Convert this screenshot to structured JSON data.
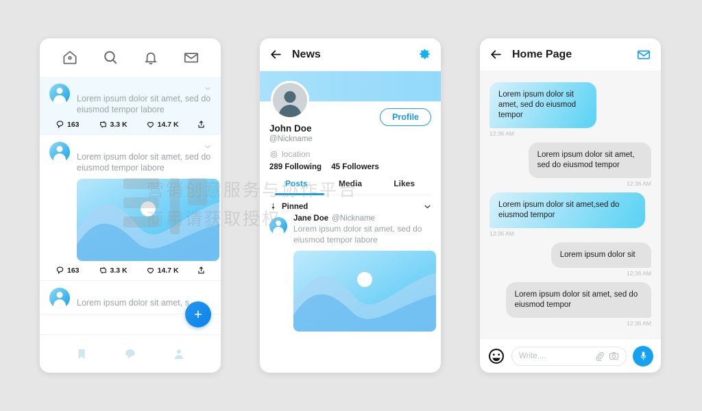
{
  "background_color": "#e6e6e6",
  "accent_color": "#1a9bf0",
  "watermark": {
    "line1": "营销创意服务与协作平台",
    "line2": "商用请获取授权"
  },
  "phone_feed": {
    "top_nav": [
      {
        "name": "home-icon",
        "label": "Home"
      },
      {
        "name": "search-icon",
        "label": "Search"
      },
      {
        "name": "bell-icon",
        "label": "Notifications"
      },
      {
        "name": "mail-icon",
        "label": "Messages"
      }
    ],
    "posts": [
      {
        "text": "Lorem ipsum dolor sit amet, sed do eiusmod tempor labore",
        "highlighted": true,
        "has_image": false,
        "stats": [
          {
            "icon": "comment-icon",
            "value": "163"
          },
          {
            "icon": "retweet-icon",
            "value": "3.3 K"
          },
          {
            "icon": "heart-icon",
            "value": "14.7 K"
          },
          {
            "icon": "share-icon",
            "value": ""
          }
        ]
      },
      {
        "text": "Lorem ipsum dolor sit amet, sed do eiusmod tempor labore",
        "highlighted": false,
        "has_image": true,
        "stats": [
          {
            "icon": "comment-icon",
            "value": "163"
          },
          {
            "icon": "retweet-icon",
            "value": "3.3 K"
          },
          {
            "icon": "heart-icon",
            "value": "14.7 K"
          },
          {
            "icon": "share-icon",
            "value": ""
          }
        ]
      },
      {
        "text": "Lorem ipsum dolor sit amet, s",
        "highlighted": false,
        "has_image": false,
        "stats": []
      }
    ],
    "fab_label": "+",
    "bottom_nav": [
      {
        "name": "bookmark-icon",
        "label": "Bookmarks"
      },
      {
        "name": "chat-bubble-icon",
        "label": "Chats"
      },
      {
        "name": "person-icon",
        "label": "Profile"
      }
    ]
  },
  "phone_profile": {
    "header": {
      "back_icon": "arrow-left-icon",
      "title": "News",
      "settings_icon": "gear-icon"
    },
    "profile_button": "Profile",
    "name": "John Doe",
    "nickname": "@Nickname",
    "location": "location",
    "following": "289 Following",
    "followers": "45 Followers",
    "tabs": [
      {
        "label": "Posts",
        "active": true
      },
      {
        "label": "Media",
        "active": false
      },
      {
        "label": "Likes",
        "active": false
      }
    ],
    "pinned_label": "Pinned",
    "post": {
      "author": "Jane Doe",
      "handle": "@Nickname",
      "text": "Lorem ipsum dolor sit amet, sed do eiusmod tempor labore"
    }
  },
  "phone_chat": {
    "header": {
      "back_icon": "arrow-left-icon",
      "title": "Home Page",
      "mail_icon": "mail-icon"
    },
    "messages": [
      {
        "side": "left",
        "text": "Lorem ipsum dolor sit amet, sed do eiusmod tempor",
        "time": "12:36 AM"
      },
      {
        "side": "right",
        "text": "Lorem ipsum dolor sit amet, sed do eiusmod tempor",
        "time": "12:36 AM"
      },
      {
        "side": "left",
        "text": "Lorem ipsum dolor sit amet,sed do eiusmod tempor",
        "time": "12:36 AM"
      },
      {
        "side": "right",
        "text": "Lorem ipsum dolor sit",
        "time": "12:36 AM"
      },
      {
        "side": "right",
        "text": "Lorem ipsum dolor sit amet, sed do eiusmod tempor",
        "time": "12:36 AM"
      }
    ],
    "input_bar": {
      "emoji_icon": "smiley-icon",
      "placeholder": "Write....",
      "attach_icon": "paperclip-icon",
      "camera_icon": "camera-icon",
      "mic_icon": "microphone-icon"
    }
  }
}
